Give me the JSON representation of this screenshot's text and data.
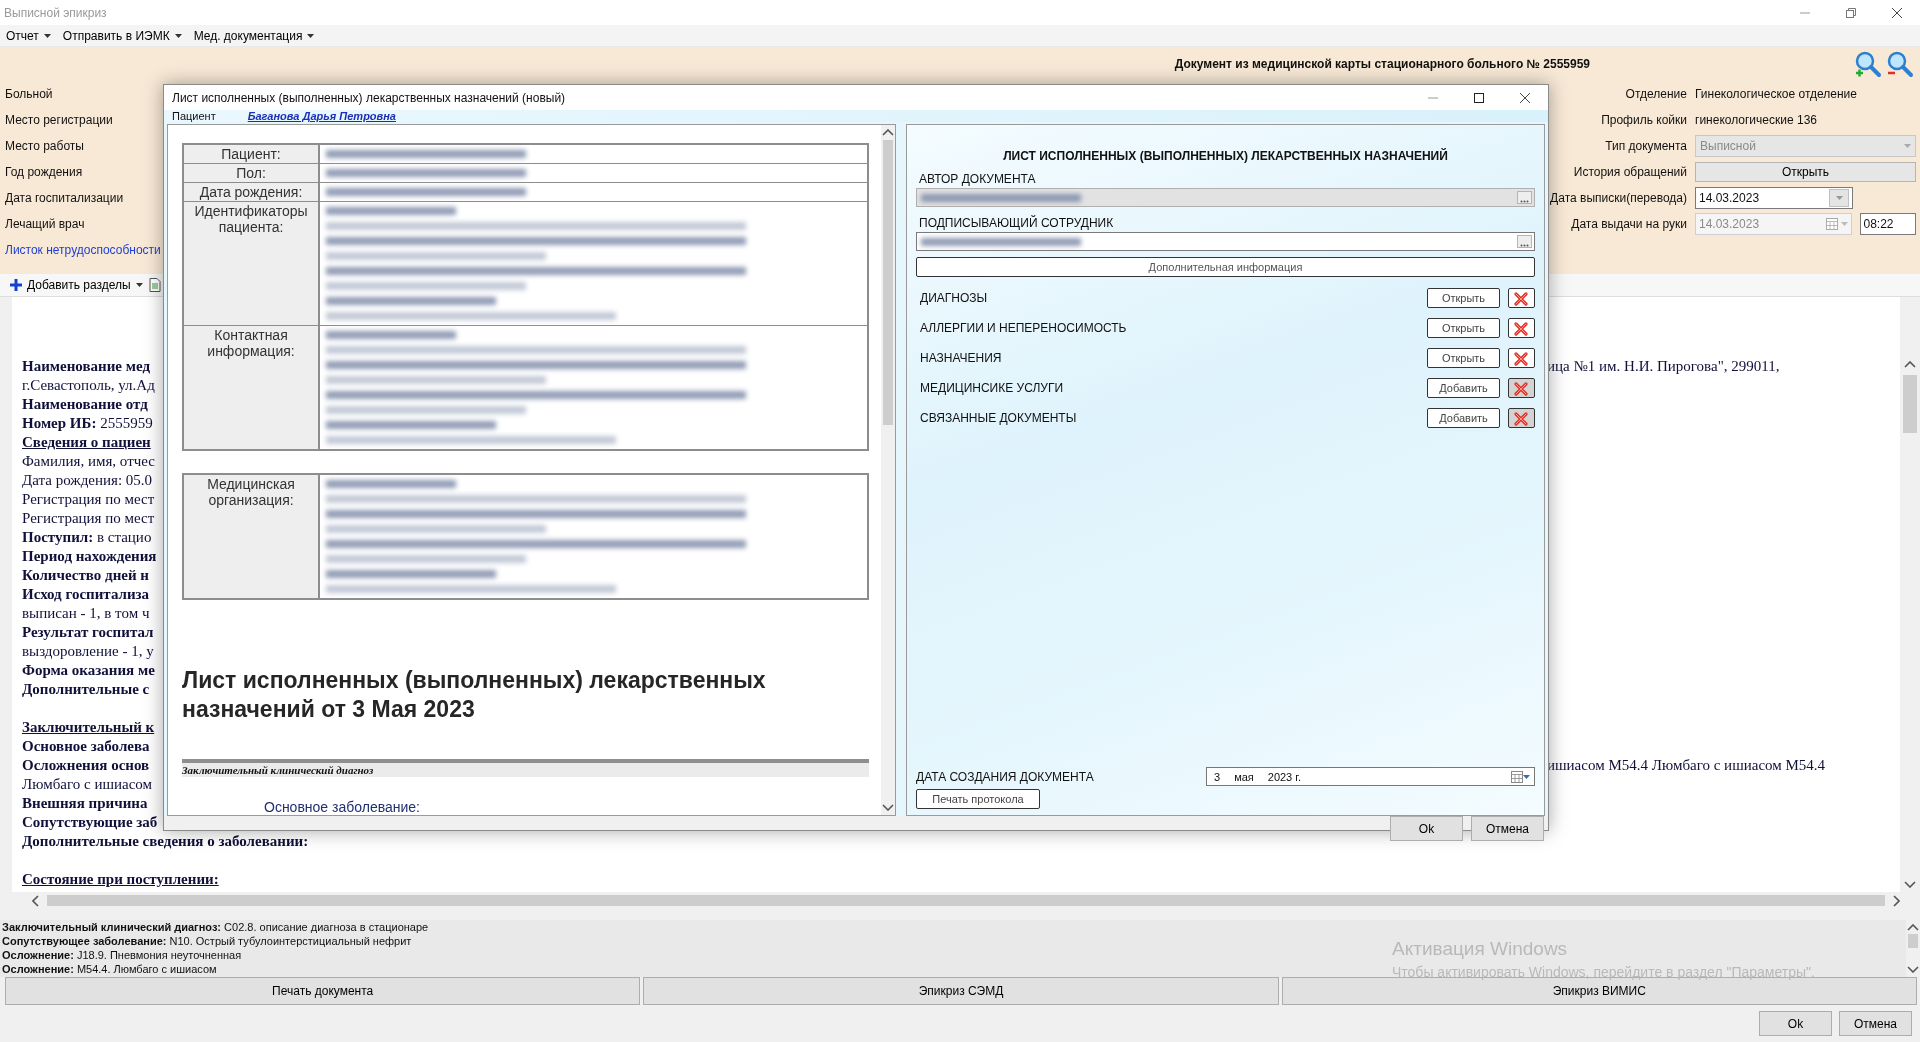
{
  "window": {
    "title": "Выписной эпикриз"
  },
  "menu": [
    {
      "label": "Отчет"
    },
    {
      "label": "Отправить в ИЭМК"
    },
    {
      "label": "Мед. документация"
    }
  ],
  "header": {
    "title": "Документ из медицинской карты стационарного больного №  2555959",
    "left_labels": [
      {
        "text": "Больной",
        "kind": "label"
      },
      {
        "text": "Место регистрации",
        "kind": "label"
      },
      {
        "text": "Место работы",
        "kind": "label"
      },
      {
        "text": "Год рождения",
        "kind": "label"
      },
      {
        "text": "Дата госпитализации",
        "kind": "label"
      },
      {
        "text": "Лечащий врач",
        "kind": "label"
      },
      {
        "text": "Листок нетрудоспособности",
        "kind": "link"
      }
    ],
    "form": [
      {
        "label": "Отделение",
        "kind": "text",
        "value": "Гинекологическое отделение"
      },
      {
        "label": "Профиль койки",
        "kind": "text",
        "value": "гинекологические 136"
      },
      {
        "label": "Тип документа",
        "kind": "select",
        "value": "Выписной",
        "disabled": true
      },
      {
        "label": "История обращений",
        "kind": "button",
        "value": "Открыть"
      },
      {
        "label": "Дата выписки(перевода)",
        "kind": "date",
        "value": "14.03.2023",
        "disabled": false
      },
      {
        "label": "Дата выдачи на руки",
        "kind": "datetime",
        "value": "14.03.2023",
        "time": "08:22",
        "disabled": true
      }
    ]
  },
  "toolbar": {
    "add_sections": "Добавить разделы"
  },
  "document_lines": [
    {
      "kind": "bold",
      "text": "Наименование мед",
      "right": "ица №1 им. Н.И. Пирогова\", 299011,"
    },
    {
      "kind": "plain",
      "text": "г.Севастополь, ул.Ад"
    },
    {
      "kind": "bold",
      "text": "Наименование отд"
    },
    {
      "kind": "plain",
      "text": "**Номер ИБ:** 2555959"
    },
    {
      "kind": "underline",
      "text": "Сведения о пациен"
    },
    {
      "kind": "plain",
      "text": "Фамилия, имя, отчес"
    },
    {
      "kind": "plain",
      "text": "Дата рождения: 05.0"
    },
    {
      "kind": "plain",
      "text": "Регистрация по мест"
    },
    {
      "kind": "plain",
      "text": "Регистрация по мест"
    },
    {
      "kind": "plain",
      "text": "**Поступил:** в стацио"
    },
    {
      "kind": "bold",
      "text": "Период нахождения"
    },
    {
      "kind": "bold",
      "text": "Количество дней н"
    },
    {
      "kind": "bold",
      "text": "Исход госпитализа"
    },
    {
      "kind": "plain",
      "text": "выписан - 1, в том ч"
    },
    {
      "kind": "bold",
      "text": "Результат госпитал"
    },
    {
      "kind": "plain",
      "text": "выздоровление - 1, у"
    },
    {
      "kind": "bold",
      "text": "Форма оказания ме"
    },
    {
      "kind": "bold",
      "text": "Дополнительные с"
    },
    {
      "kind": "gap"
    },
    {
      "kind": "underline",
      "text": "Заключительный к"
    },
    {
      "kind": "bold",
      "text": "Основное заболева"
    },
    {
      "kind": "bold",
      "text": "Осложнения основ",
      "right": "ишиасом M54.4 Люмбаго с ишиасом M54.4"
    },
    {
      "kind": "plain",
      "text": "Люмбаго с ишиасом"
    },
    {
      "kind": "bold",
      "text": "Внешняя причина"
    },
    {
      "kind": "bold",
      "text": "Сопутствующие заб"
    },
    {
      "kind": "wide",
      "text": "Дополнительные сведения о заболевании:"
    },
    {
      "kind": "gap"
    },
    {
      "kind": "wide_underline",
      "text": "Состояние при поступлении:"
    }
  ],
  "summary": [
    "**Заключительный клинический диагноз:** C02.8. описание диагноза в стационаре",
    "**Сопутствующее заболевание:** N10. Острый тубулоинтерстициальный нефрит",
    "**Осложнение:** J18.9. Пневмония неуточненная",
    "**Осложнение:** M54.4. Люмбаго с ишиасом"
  ],
  "bottom_buttons": [
    "Печать документа",
    "Эпикриз СЭМД",
    "Эпикриз ВИМИС"
  ],
  "footer_buttons": [
    "Ok",
    "Отмена"
  ],
  "os_notice": {
    "title": "Активация Windows",
    "text": "Чтобы активировать Windows, перейдите в раздел \"Параметры\"."
  },
  "dialog": {
    "title": "Лист исполненных (выполненных) лекарственных назначений (новый)",
    "patient_label": "Пациент",
    "patient_name": "Баганова Дарья Петровна",
    "preview": {
      "tables": [
        [
          {
            "label": "Пациент:",
            "kind": "single"
          },
          {
            "label": "Пол:",
            "kind": "single"
          },
          {
            "label": "Дата рождения:",
            "kind": "single"
          },
          {
            "label": "Идентификаторы пациента:",
            "kind": "block"
          },
          {
            "label": "Контактная информация:",
            "kind": "block"
          }
        ],
        [
          {
            "label": "Медицинская организация:",
            "kind": "block"
          }
        ]
      ],
      "heading": "Лист исполненных (выполненных) лекарственных назначений от 3 Мая 2023",
      "section_title": "Заключительный клинический диагноз",
      "field_label": "Основное заболевание:"
    },
    "form": {
      "title": "ЛИСТ ИСПОЛНЕННЫХ (ВЫПОЛНЕННЫХ) ЛЕКАРСТВЕННЫХ НАЗНАЧЕНИЙ",
      "fields": [
        {
          "label": "АВТОР ДОКУМЕНТА",
          "disabled": true
        },
        {
          "label": "ПОДПИСЫВАЮЩИЙ СОТРУДНИК",
          "disabled": false
        }
      ],
      "more_info": "Дополнительная информация",
      "sections": [
        {
          "label": "ДИАГНОЗЫ",
          "action": "Открыть",
          "disabled": false
        },
        {
          "label": "АЛЛЕРГИИ И НЕПЕРЕНОСИМОСТЬ",
          "action": "Открыть",
          "disabled": false
        },
        {
          "label": "НАЗНАЧЕНИЯ",
          "action": "Открыть",
          "disabled": false
        },
        {
          "label": "МЕДИЦИНСИКЕ УСЛУГИ",
          "action": "Добавить",
          "disabled": true
        },
        {
          "label": "СВЯЗАННЫЕ ДОКУМЕНТЫ",
          "action": "Добавить",
          "disabled": true
        }
      ],
      "date_label": "ДАТА СОЗДАНИЯ ДОКУМЕНТА",
      "date_day": "3",
      "date_month": "мая",
      "date_year": "2023 г.",
      "print": "Печать протокола"
    },
    "buttons": [
      "Ok",
      "Отмена"
    ]
  }
}
